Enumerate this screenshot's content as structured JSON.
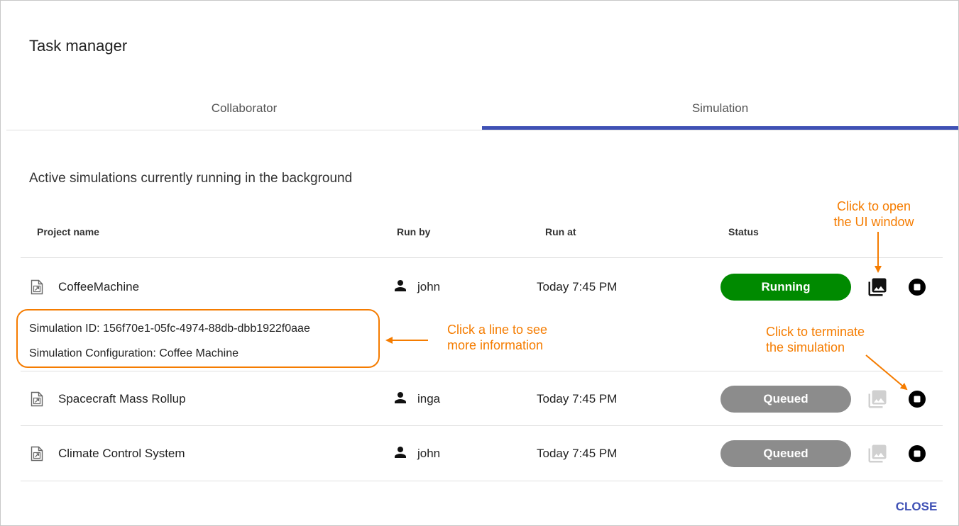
{
  "dialog": {
    "title": "Task manager"
  },
  "tabs": [
    {
      "label": "Collaborator",
      "active": false
    },
    {
      "label": "Simulation",
      "active": true
    }
  ],
  "subtitle": "Active simulations currently running in the background",
  "columns": {
    "project": "Project name",
    "run_by": "Run by",
    "run_at": "Run at",
    "status": "Status"
  },
  "rows": [
    {
      "project": "CoffeeMachine",
      "run_by": "john",
      "run_at": "Today 7:45 PM",
      "status": "Running",
      "ui_enabled": true
    },
    {
      "project": "Spacecraft Mass Rollup",
      "run_by": "inga",
      "run_at": "Today 7:45 PM",
      "status": "Queued",
      "ui_enabled": false
    },
    {
      "project": "Climate Control System",
      "run_by": "john",
      "run_at": "Today 7:45 PM",
      "status": "Queued",
      "ui_enabled": false
    }
  ],
  "details": {
    "simulation_id": "Simulation ID: 156f70e1-05fc-4974-88db-dbb1922f0aae",
    "configuration": "Simulation Configuration: Coffee Machine"
  },
  "annotations": {
    "open_ui": [
      "Click to open",
      "the UI window"
    ],
    "line_info": [
      "Click a line to see",
      "more information"
    ],
    "terminate": [
      "Click to terminate",
      "the simulation"
    ]
  },
  "footer": {
    "close_label": "CLOSE"
  },
  "colors": {
    "accent": "#3f51b5",
    "running": "#008a00",
    "queued": "#8c8c8c",
    "annotation": "#f57c00"
  },
  "icons": {
    "file": "file-link-icon",
    "user": "person-icon",
    "ui": "photo-library-icon",
    "stop": "stop-circle-icon"
  }
}
